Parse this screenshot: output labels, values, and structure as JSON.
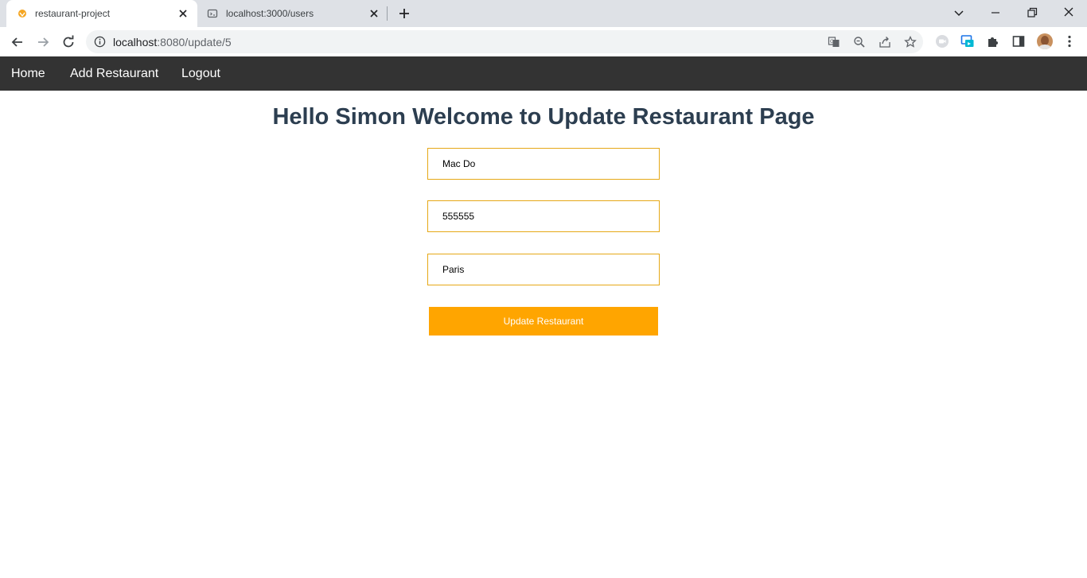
{
  "browser": {
    "tabs": [
      {
        "title": "restaurant-project",
        "active": true
      },
      {
        "title": "localhost:3000/users",
        "active": false
      }
    ],
    "address": {
      "host": "localhost",
      "path": ":8080/update/5"
    },
    "icons": {
      "back": "arrow-left-icon",
      "forward": "arrow-right-icon",
      "reload": "reload-icon",
      "site_info": "info-icon",
      "translate": "translate-icon",
      "zoom": "zoom-out-icon",
      "share": "share-icon",
      "bookmark": "star-icon",
      "extension_1": "meet-icon",
      "extension_2": "cast-icon",
      "extensions": "puzzle-icon",
      "side_panel": "side-panel-icon",
      "menu": "kebab-menu-icon"
    }
  },
  "nav": {
    "items": [
      {
        "label": "Home"
      },
      {
        "label": "Add Restaurant"
      },
      {
        "label": "Logout"
      }
    ]
  },
  "page": {
    "heading": "Hello Simon Welcome to Update Restaurant Page",
    "fields": [
      {
        "value": "Mac Do"
      },
      {
        "value": "555555"
      },
      {
        "value": "Paris"
      }
    ],
    "submit_label": "Update Restaurant"
  },
  "colors": {
    "nav_bg": "#333333",
    "accent": "#ffa500",
    "input_border": "#e6a817",
    "heading": "#2c3e50"
  }
}
